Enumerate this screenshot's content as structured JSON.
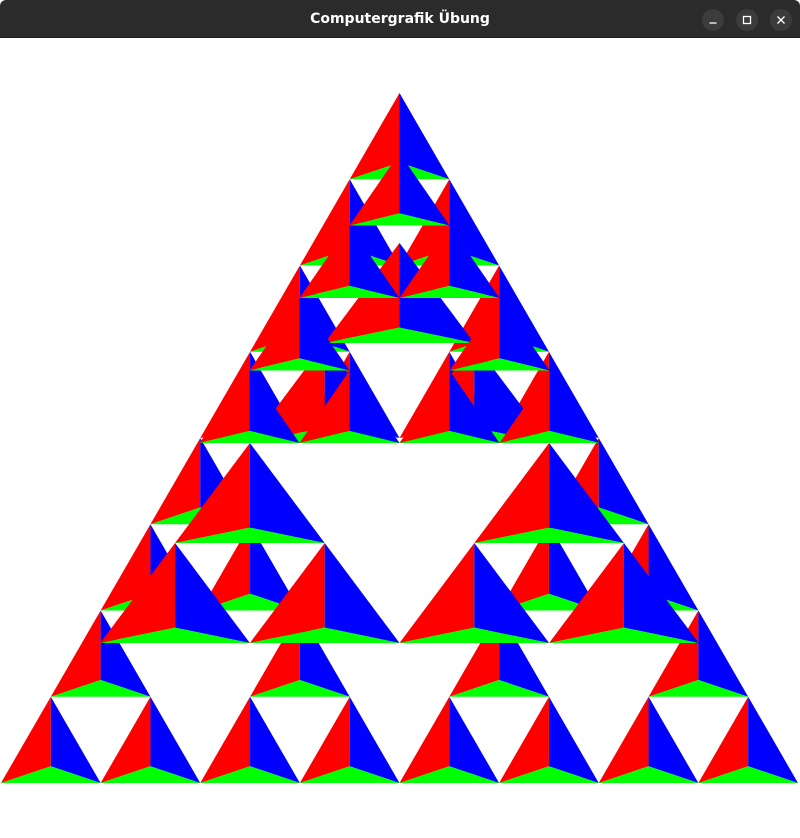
{
  "window": {
    "title": "Computergrafik Übung",
    "controls": [
      {
        "name": "minimize",
        "icon": "minimize-icon"
      },
      {
        "name": "maximize",
        "icon": "maximize-icon"
      },
      {
        "name": "close",
        "icon": "close-icon"
      }
    ]
  },
  "scene": {
    "description_colors": {
      "background": "#ffffff",
      "red": "#ff0000",
      "green": "#00ff00",
      "blue": "#0000ff"
    },
    "fractal": "sierpinski-triangle",
    "subdivision_depth": 3,
    "copies": 3
  }
}
